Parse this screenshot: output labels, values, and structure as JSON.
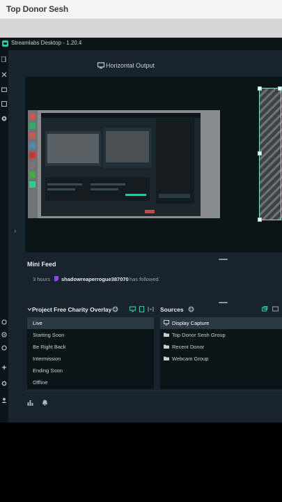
{
  "overlay": {
    "top_label": "Top Donor Sesh"
  },
  "window": {
    "title": "Streamlabs Desktop - 1.20.4"
  },
  "preview": {
    "title": "Horizontal Output"
  },
  "mini_feed": {
    "title": "Mini Feed",
    "items": [
      {
        "time": "3 hours",
        "user": "shadowreaperrogue387070",
        "action": "has followed"
      }
    ]
  },
  "scenes": {
    "title": "Project Free Charity Overlay",
    "items": [
      "Live",
      "Starting Soon",
      "Be Right Back",
      "Intermission",
      "Ending Soon",
      "Offline"
    ],
    "active": "Live"
  },
  "sources": {
    "title": "Sources",
    "items": [
      {
        "label": "Display Capture",
        "icon": "monitor-icon"
      },
      {
        "label": "Top Donor Sesh Group",
        "icon": "folder-icon"
      },
      {
        "label": "Recent Donor",
        "icon": "folder-icon"
      },
      {
        "label": "Webcam Group",
        "icon": "folder-icon"
      }
    ]
  },
  "colors": {
    "app_bg": "#17242d",
    "panel_bg": "#0b1419",
    "accent": "#31c3a2",
    "selection": "#8fd9c6"
  }
}
